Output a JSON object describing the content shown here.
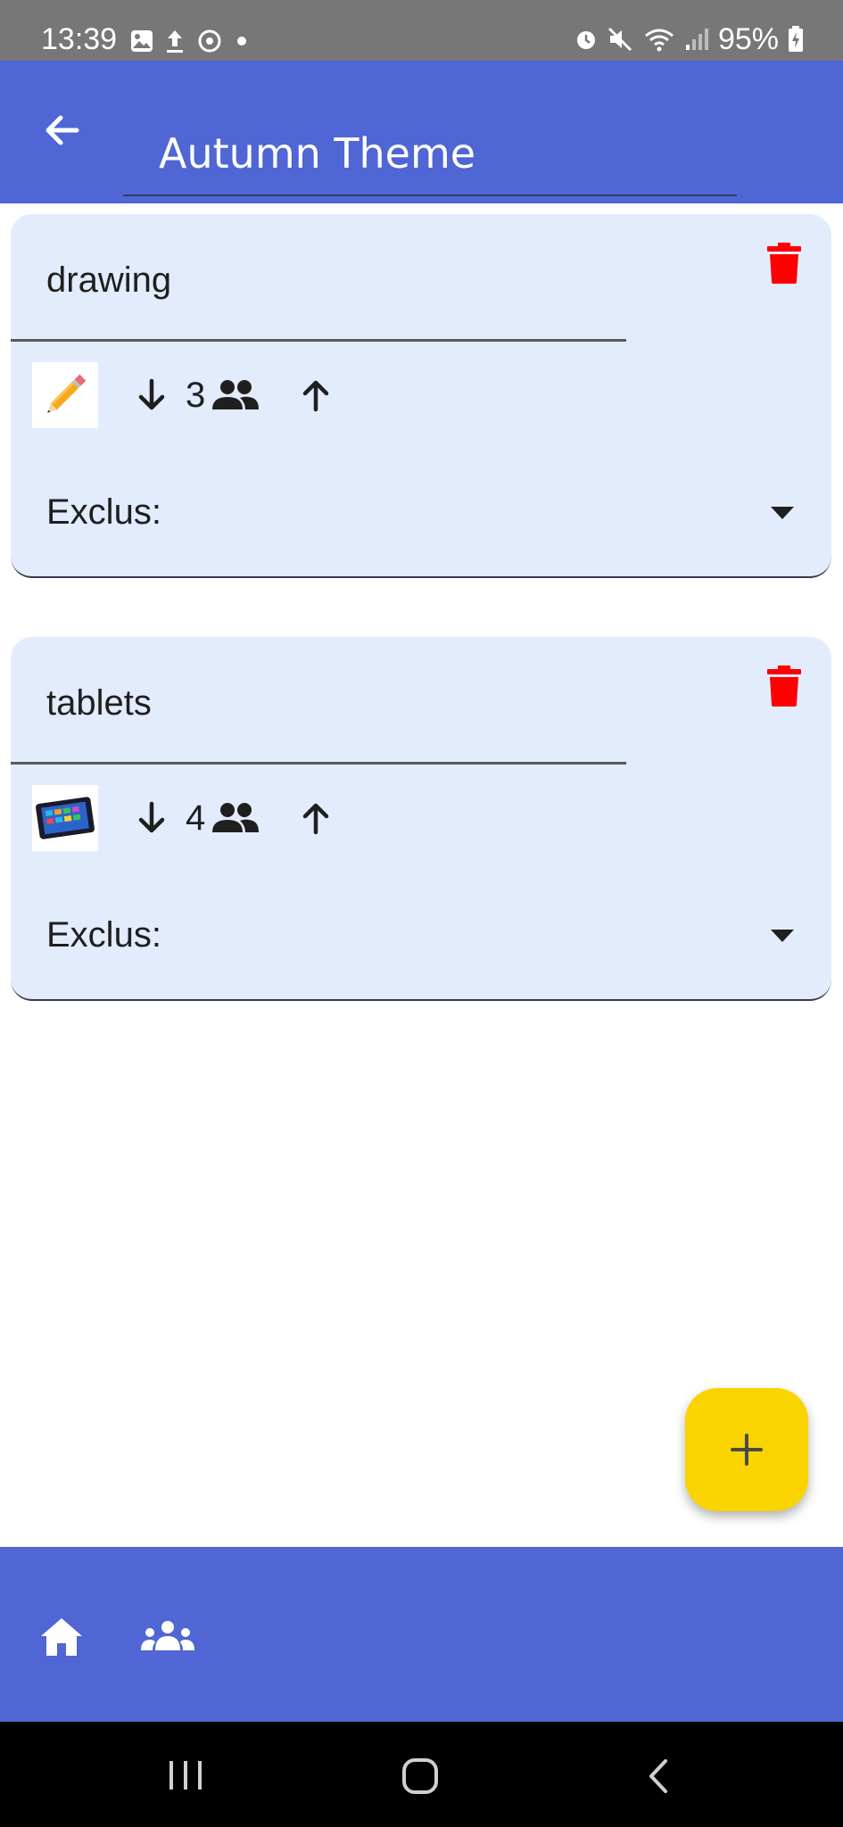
{
  "status_bar": {
    "time": "13:39",
    "battery": "95%",
    "left_icons": [
      "gallery-icon",
      "upload-icon",
      "sync-icon",
      "dot-icon"
    ],
    "right_icons": [
      "alarm-icon",
      "mute-icon",
      "wifi-icon",
      "signal-icon",
      "battery-charging-icon"
    ]
  },
  "app_bar": {
    "title": "Autumn Theme",
    "back_icon": "arrow-back-icon",
    "color": "#4f66d4"
  },
  "cards": [
    {
      "name": "drawing",
      "count": "3",
      "image": "pencil-image",
      "exclus_label": "Exclus:"
    },
    {
      "name": "tablets",
      "count": "4",
      "image": "tablet-image",
      "exclus_label": "Exclus:"
    }
  ],
  "colors": {
    "card_background": "#e3ecfc",
    "delete": "#ff0000",
    "fab": "#fad400",
    "nav": "#4f66d4"
  },
  "fab": {
    "icon": "plus-icon"
  },
  "bottom_nav": {
    "items": [
      "home-icon",
      "groups-icon"
    ]
  },
  "system_nav": {
    "items": [
      "recent-apps-icon",
      "home-circle-icon",
      "back-chevron-icon"
    ]
  }
}
